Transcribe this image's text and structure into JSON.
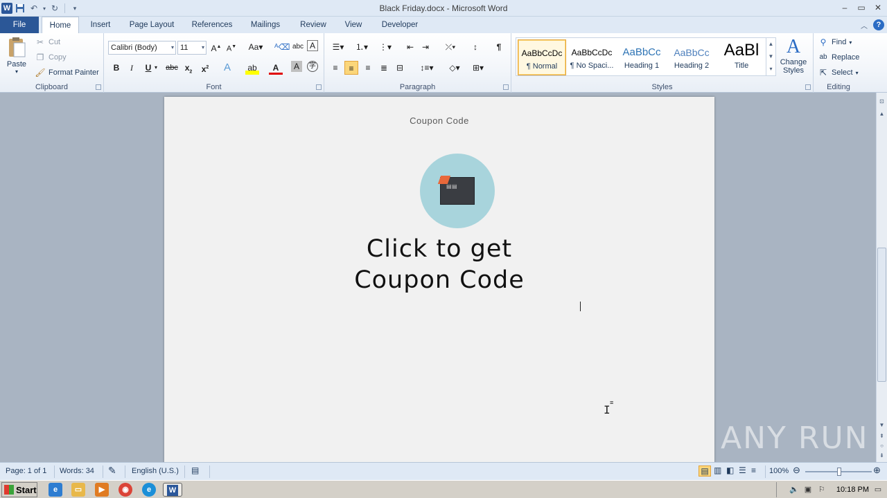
{
  "window": {
    "title": "Black Friday.docx - Microsoft Word",
    "app_icon": "W"
  },
  "qat": {
    "save_icon": "floppy",
    "undo_icon": "undo",
    "redo_icon": "redo"
  },
  "tabs": [
    {
      "label": "File"
    },
    {
      "label": "Home"
    },
    {
      "label": "Insert"
    },
    {
      "label": "Page Layout"
    },
    {
      "label": "References"
    },
    {
      "label": "Mailings"
    },
    {
      "label": "Review"
    },
    {
      "label": "View"
    },
    {
      "label": "Developer"
    }
  ],
  "ribbon": {
    "clipboard": {
      "label": "Clipboard",
      "paste": "Paste",
      "cut": "Cut",
      "copy": "Copy",
      "format_painter": "Format Painter"
    },
    "font": {
      "label": "Font",
      "family": "Calibri (Body)",
      "size": "11"
    },
    "paragraph": {
      "label": "Paragraph"
    },
    "styles": {
      "label": "Styles",
      "items": [
        {
          "sample": "AaBbCcDc",
          "name": "¶ Normal",
          "color": "#000000"
        },
        {
          "sample": "AaBbCcDc",
          "name": "¶ No Spaci...",
          "color": "#000000"
        },
        {
          "sample": "AaBbCc",
          "name": "Heading 1",
          "color": "#2e74b5"
        },
        {
          "sample": "AaBbCc",
          "name": "Heading 2",
          "color": "#4f81bd"
        },
        {
          "sample": "AaBl",
          "name": "Title",
          "color": "#000000"
        }
      ],
      "change_styles": "Change Styles"
    },
    "editing": {
      "label": "Editing",
      "find": "Find",
      "replace": "Replace",
      "select": "Select"
    }
  },
  "document": {
    "header_text": "Coupon Code",
    "cta_line1": "Click to get",
    "cta_line2": "Coupon Code"
  },
  "watermark": "ANY RUN",
  "statusbar": {
    "page": "Page: 1 of 1",
    "words": "Words: 34",
    "language": "English (U.S.)",
    "zoom": "100%",
    "zoom_level_percent": 100
  },
  "taskbar": {
    "start": "Start",
    "clock": "10:18 PM"
  },
  "colors": {
    "file_tab": "#2b5797",
    "page_bg": "#f1f1f1",
    "badge": "#a8d4dc"
  }
}
